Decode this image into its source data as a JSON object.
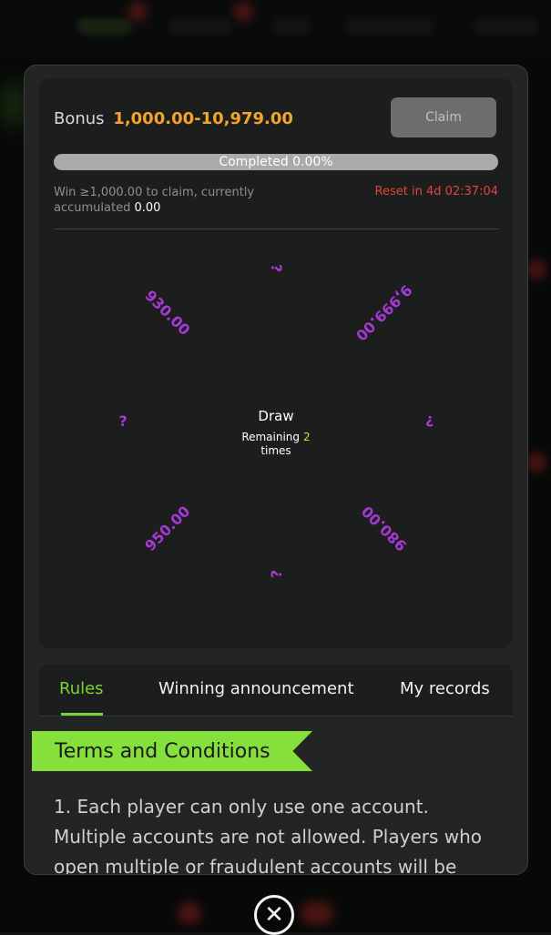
{
  "bonus": {
    "label": "Bonus",
    "range": "1,000.00-10,979.00",
    "claim_label": "Claim"
  },
  "progress": {
    "text": "Completed 0.00%",
    "percent": 0
  },
  "requirement": {
    "text": "Win ≥1,000.00 to claim, currently accumulated",
    "accumulated": "0.00",
    "reset": "Reset in 4d 02:37:04"
  },
  "wheel": {
    "center_title": "Draw",
    "remaining_label": "Remaining",
    "remaining_count": "2",
    "remaining_unit": "times",
    "segments": [
      "?",
      "9,999.00",
      "?",
      "980.00",
      "?",
      "950.00",
      "?",
      "930.00"
    ],
    "prize_color": "#a638d6"
  },
  "tabs": [
    {
      "label": "Rules",
      "active": true
    },
    {
      "label": "Winning announcement",
      "active": false
    },
    {
      "label": "My records",
      "active": false
    }
  ],
  "terms": {
    "title": "Terms and Conditions",
    "text": "1. Each player can only use one account. Multiple accounts are not allowed. Players who open multiple or fraudulent accounts will be"
  },
  "close_icon": "close-icon",
  "colors": {
    "accent_green": "#7bd33a",
    "bonus_orange": "#f2a528",
    "reset_red": "#e2453c"
  }
}
